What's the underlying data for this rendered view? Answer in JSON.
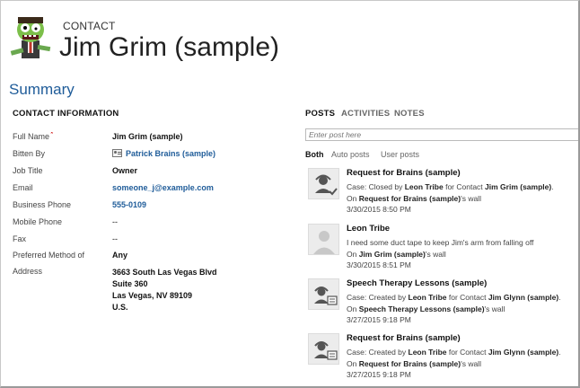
{
  "header": {
    "entity_type": "CONTACT",
    "record_name": "Jim Grim (sample)"
  },
  "summary_heading": "Summary",
  "contact_info": {
    "title": "CONTACT INFORMATION",
    "fields": [
      {
        "label": "Full Name",
        "required": "*",
        "value": "Jim Grim (sample)"
      },
      {
        "label": "Bitten By",
        "value": "Patrick Brains (sample)"
      },
      {
        "label": "Job Title",
        "value": "Owner"
      },
      {
        "label": "Email",
        "value": "someone_j@example.com"
      },
      {
        "label": "Business Phone",
        "value": "555-0109"
      },
      {
        "label": "Mobile Phone",
        "value": "--"
      },
      {
        "label": "Fax",
        "value": "--"
      },
      {
        "label": "Preferred Method of",
        "value": "Any"
      },
      {
        "label": "Address",
        "lines": [
          "3663 South Las Vegas Blvd",
          "Suite 360",
          "Las Vegas, NV 89109",
          "U.S."
        ]
      }
    ]
  },
  "social": {
    "tabs": [
      "POSTS",
      "ACTIVITIES",
      "NOTES"
    ],
    "post_placeholder": "Enter post here",
    "filters": [
      "Both",
      "Auto posts",
      "User posts"
    ],
    "posts": [
      {
        "icon": "case-closed-icon",
        "title": "Request for Brains (sample)",
        "line1_pre": "Case: Closed by ",
        "line1_who": "Leon Tribe",
        "line1_mid": " for Contact ",
        "line1_target": "Jim Grim (sample)",
        "line1_post": ".",
        "line2_pre": "On ",
        "line2_target": "Request for Brains (sample)",
        "line2_post": "'s wall",
        "time": "3/30/2015 8:50 PM"
      },
      {
        "icon": "user-placeholder-icon",
        "title": "Leon Tribe",
        "text": "I need some duct tape to keep Jim's arm from falling off",
        "line2_pre": "On ",
        "line2_target": "Jim Grim (sample)",
        "line2_post": "'s wall",
        "time": "3/30/2015 8:51 PM"
      },
      {
        "icon": "case-created-icon",
        "title": "Speech Therapy Lessons (sample)",
        "line1_pre": "Case: Created by ",
        "line1_who": "Leon Tribe",
        "line1_mid": " for Contact ",
        "line1_target": "Jim Glynn (sample)",
        "line1_post": ".",
        "line2_pre": "On ",
        "line2_target": "Speech Therapy Lessons (sample)",
        "line2_post": "'s wall",
        "time": "3/27/2015 9:18 PM"
      },
      {
        "icon": "case-created-icon",
        "title": "Request for Brains (sample)",
        "line1_pre": "Case: Created by ",
        "line1_who": "Leon Tribe",
        "line1_mid": " for Contact ",
        "line1_target": "Jim Glynn (sample)",
        "line1_post": ".",
        "line2_pre": "On ",
        "line2_target": "Request for Brains (sample)",
        "line2_post": "'s wall",
        "time": "3/27/2015 9:18 PM"
      }
    ]
  },
  "colors": {
    "accent": "#1f5c99",
    "required": "#cc0000"
  }
}
